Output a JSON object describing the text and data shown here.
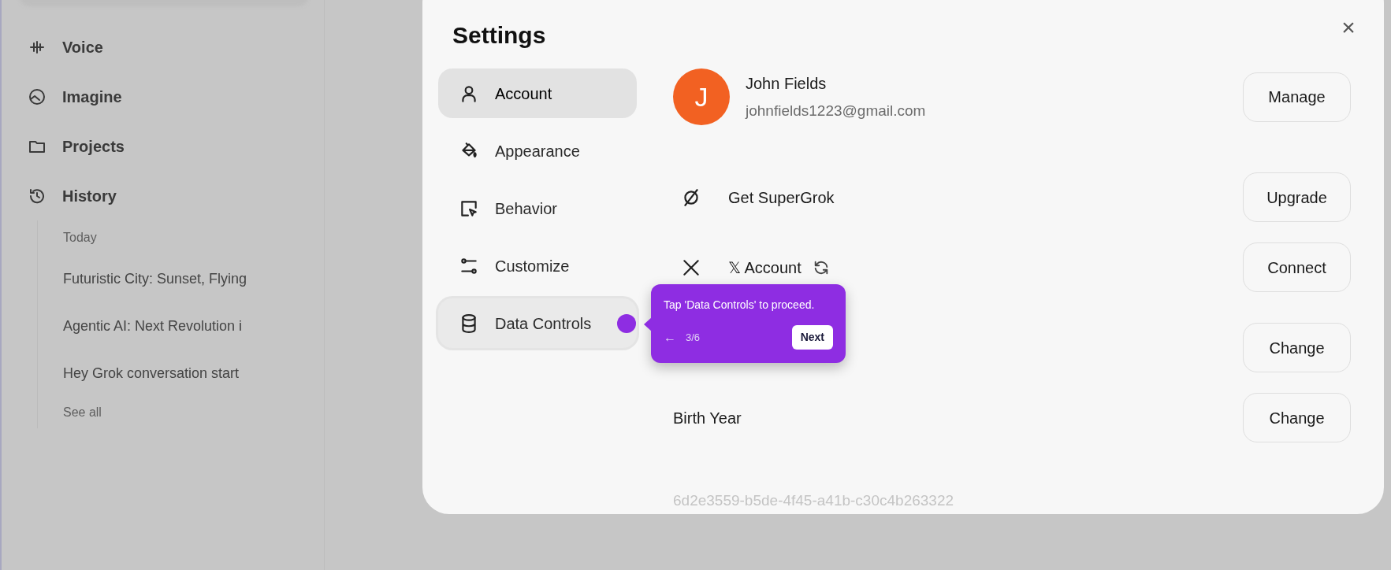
{
  "sidebar": {
    "items": [
      {
        "label": "Voice"
      },
      {
        "label": "Imagine"
      },
      {
        "label": "Projects"
      },
      {
        "label": "History"
      }
    ],
    "history": {
      "section": "Today",
      "chats": [
        "Futuristic City: Sunset, Flying",
        "Agentic AI: Next Revolution i",
        "Hey Grok conversation start"
      ],
      "see_all": "See all"
    }
  },
  "settings": {
    "title": "Settings",
    "close": "×",
    "nav": [
      {
        "label": "Account",
        "selected": true,
        "highlighted": false
      },
      {
        "label": "Appearance",
        "selected": false,
        "highlighted": false
      },
      {
        "label": "Behavior",
        "selected": false,
        "highlighted": false
      },
      {
        "label": "Customize",
        "selected": false,
        "highlighted": false
      },
      {
        "label": "Data Controls",
        "selected": false,
        "highlighted": true
      }
    ],
    "profile": {
      "initial": "J",
      "name": "John Fields",
      "email": "johnfields1223@gmail.com",
      "button": "Manage"
    },
    "rows": [
      {
        "kind": "icon",
        "label": "Get SuperGrok",
        "button": "Upgrade"
      },
      {
        "kind": "x",
        "label": "𝕏 Account",
        "button": "Connect"
      },
      {
        "kind": "hidden",
        "button": "Change"
      },
      {
        "kind": "plain",
        "label": "Birth Year",
        "button": "Change"
      }
    ],
    "user_id": "6d2e3559-b5de-4f45-a41b-c30c4b263322"
  },
  "tour": {
    "message": "Tap 'Data Controls' to proceed.",
    "back": "←",
    "step": "3/6",
    "next": "Next"
  }
}
